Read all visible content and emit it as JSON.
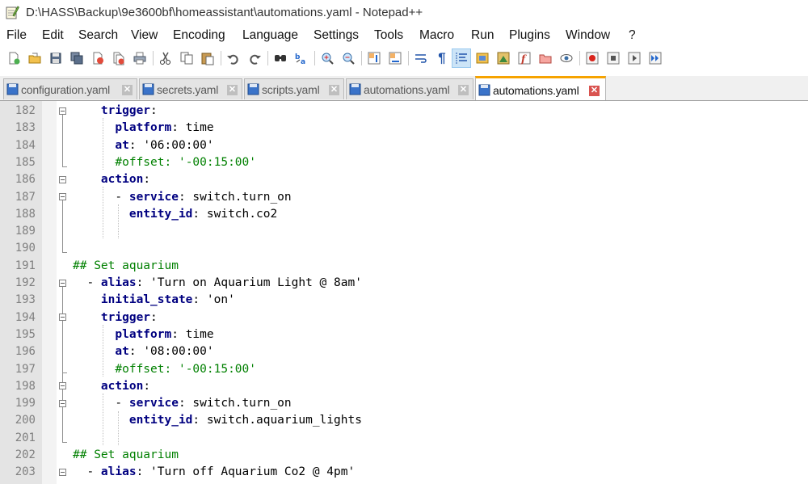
{
  "window": {
    "title": "D:\\HASS\\Backup\\9e3600bf\\homeassistant\\automations.yaml - Notepad++",
    "app_icon": "notepad-icon"
  },
  "menu": [
    "File",
    "Edit",
    "Search",
    "View",
    "Encoding",
    "Language",
    "Settings",
    "Tools",
    "Macro",
    "Run",
    "Plugins",
    "Window",
    "?"
  ],
  "toolbar": {
    "buttons": [
      "new-file-icon",
      "open-file-icon",
      "save-icon",
      "save-all-icon",
      "close-icon",
      "close-all-icon",
      "print-icon",
      "cut-icon",
      "copy-icon",
      "paste-icon",
      "undo-icon",
      "redo-icon",
      "find-icon",
      "replace-icon",
      "zoom-in-icon",
      "zoom-out-icon",
      "sync-vertical-icon",
      "sync-horizontal-icon",
      "word-wrap-icon",
      "show-all-chars-icon",
      "indent-guide-icon",
      "udl-icon",
      "doc-map-icon",
      "function-list-icon",
      "folder-workspace-icon",
      "monitoring-icon",
      "record-macro-icon",
      "stop-macro-icon",
      "play-macro-icon",
      "run-macro-multiple-icon"
    ],
    "active": "indent-guide-icon"
  },
  "tabs": [
    {
      "label": "configuration.yaml",
      "active": false
    },
    {
      "label": "secrets.yaml",
      "active": false
    },
    {
      "label": "scripts.yaml",
      "active": false
    },
    {
      "label": "automations.yaml",
      "active": false
    },
    {
      "label": "automations.yaml",
      "active": true
    }
  ],
  "editor": {
    "colors": {
      "keyword": "#000080",
      "comment": "#008000",
      "gutter_bg": "#e4e4e4",
      "line_number": "#808080",
      "active_tab": "#f6a300"
    },
    "lines": [
      {
        "n": "182",
        "tokens": [
          [
            "    ",
            ""
          ],
          [
            "trigger",
            "k"
          ],
          [
            ":",
            ""
          ]
        ]
      },
      {
        "n": "183",
        "tokens": [
          [
            "      ",
            ""
          ],
          [
            "platform",
            "k"
          ],
          [
            ": time",
            ""
          ]
        ]
      },
      {
        "n": "184",
        "tokens": [
          [
            "      ",
            ""
          ],
          [
            "at",
            "k"
          ],
          [
            ": '06:00:00'",
            ""
          ]
        ]
      },
      {
        "n": "185",
        "tokens": [
          [
            "      ",
            ""
          ],
          [
            "#offset: '-00:15:00'",
            "c"
          ]
        ]
      },
      {
        "n": "186",
        "tokens": [
          [
            "    ",
            ""
          ],
          [
            "action",
            "k"
          ],
          [
            ":",
            ""
          ]
        ]
      },
      {
        "n": "187",
        "tokens": [
          [
            "      - ",
            ""
          ],
          [
            "service",
            "k"
          ],
          [
            ": switch.turn_on",
            ""
          ]
        ]
      },
      {
        "n": "188",
        "tokens": [
          [
            "        ",
            ""
          ],
          [
            "entity_id",
            "k"
          ],
          [
            ": switch.co2",
            ""
          ]
        ]
      },
      {
        "n": "189",
        "tokens": []
      },
      {
        "n": "190",
        "tokens": []
      },
      {
        "n": "191",
        "tokens": [
          [
            "## Set aquarium",
            "c"
          ]
        ]
      },
      {
        "n": "192",
        "tokens": [
          [
            "  - ",
            ""
          ],
          [
            "alias",
            "k"
          ],
          [
            ": 'Turn on Aquarium Light @ 8am'",
            ""
          ]
        ]
      },
      {
        "n": "193",
        "tokens": [
          [
            "    ",
            ""
          ],
          [
            "initial_state",
            "k"
          ],
          [
            ": 'on'",
            ""
          ]
        ]
      },
      {
        "n": "194",
        "tokens": [
          [
            "    ",
            ""
          ],
          [
            "trigger",
            "k"
          ],
          [
            ":",
            ""
          ]
        ]
      },
      {
        "n": "195",
        "tokens": [
          [
            "      ",
            ""
          ],
          [
            "platform",
            "k"
          ],
          [
            ": time",
            ""
          ]
        ]
      },
      {
        "n": "196",
        "tokens": [
          [
            "      ",
            ""
          ],
          [
            "at",
            "k"
          ],
          [
            ": '08:00:00'",
            ""
          ]
        ]
      },
      {
        "n": "197",
        "tokens": [
          [
            "      ",
            ""
          ],
          [
            "#offset: '-00:15:00'",
            "c"
          ]
        ]
      },
      {
        "n": "198",
        "tokens": [
          [
            "    ",
            ""
          ],
          [
            "action",
            "k"
          ],
          [
            ":",
            ""
          ]
        ]
      },
      {
        "n": "199",
        "tokens": [
          [
            "      - ",
            ""
          ],
          [
            "service",
            "k"
          ],
          [
            ": switch.turn_on",
            ""
          ]
        ]
      },
      {
        "n": "200",
        "tokens": [
          [
            "        ",
            ""
          ],
          [
            "entity_id",
            "k"
          ],
          [
            ": switch.aquarium_lights",
            ""
          ]
        ]
      },
      {
        "n": "201",
        "tokens": []
      },
      {
        "n": "202",
        "tokens": [
          [
            "## Set aquarium",
            "c"
          ]
        ]
      },
      {
        "n": "203",
        "tokens": [
          [
            "  - ",
            ""
          ],
          [
            "alias",
            "k"
          ],
          [
            ": 'Turn off Aquarium Co2 @ 4pm'",
            ""
          ]
        ]
      }
    ]
  }
}
